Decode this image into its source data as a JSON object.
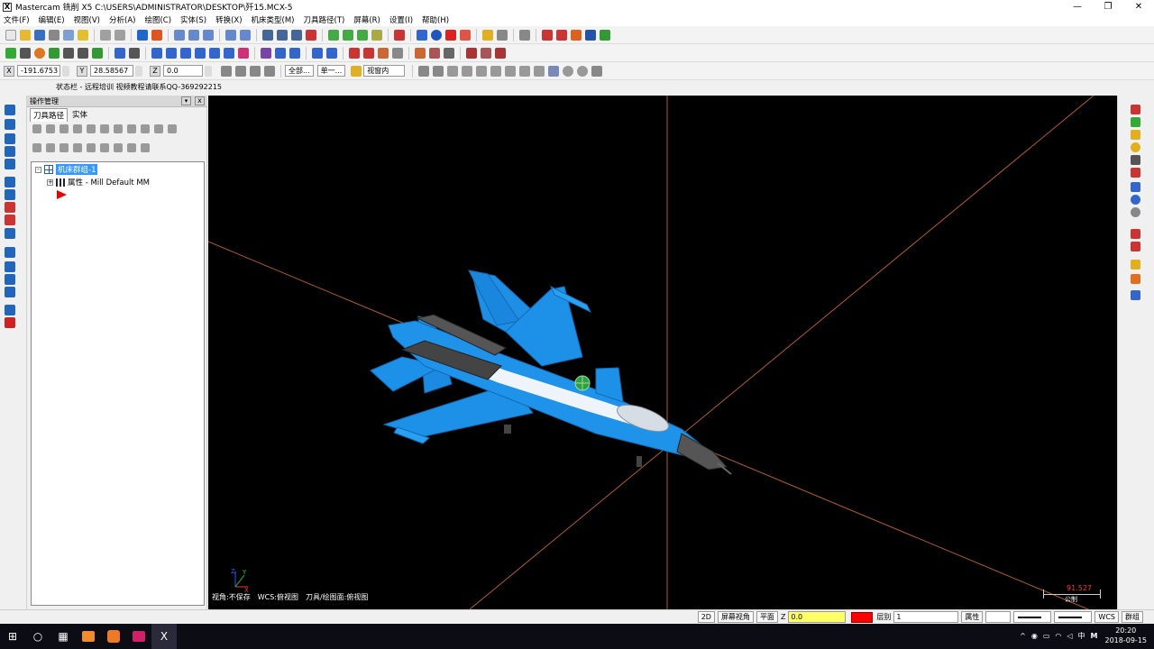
{
  "window": {
    "title": "Mastercam 铣削 X5  C:\\USERS\\ADMINISTRATOR\\DESKTOP\\歼15.MCX-5",
    "min": "—",
    "restore": "❐",
    "close": "✕"
  },
  "menu": [
    "文件(F)",
    "编辑(E)",
    "视图(V)",
    "分析(A)",
    "绘图(C)",
    "实体(S)",
    "转换(X)",
    "机床类型(M)",
    "刀具路径(T)",
    "屏幕(R)",
    "设置(I)",
    "帮助(H)"
  ],
  "coords": {
    "x_label": "X",
    "x_value": "-191.6753",
    "y_label": "Y",
    "y_value": "28.58567",
    "z_label": "Z",
    "z_value": "0.0"
  },
  "toolbar3": {
    "all_label": "全部...",
    "single_label": "单一...",
    "view_mode": "视窗内"
  },
  "status_line": "状态栏 - 远程培训 视频教程请联系QQ-369292215",
  "ops_panel": {
    "title": "操作管理",
    "pin": "▾",
    "close": "x",
    "tabs": [
      "刀具路径",
      "实体"
    ],
    "tree": {
      "group": "机床群组-1",
      "props": "属性 - Mill Default MM",
      "expand": "-",
      "expand2": "+"
    }
  },
  "viewport": {
    "view_label": "视角:不保存",
    "wcs_label": "WCS:俯视图",
    "plane_label": "刀具/绘图面:俯视图",
    "scale_value": "91.527",
    "scale_unit": "公制"
  },
  "bottom_bar": {
    "mode2d": "2D",
    "screen_view": "屏幕视角",
    "plane": "平面",
    "z_label": "Z",
    "z_value": "0.0",
    "level_label": "层别",
    "level_value": "1",
    "attr": "属性",
    "wcs": "WCS",
    "group": "群组"
  },
  "taskbar": {
    "ime": "中",
    "mode": "M",
    "time": "20:20",
    "date": "2018-09-15"
  }
}
